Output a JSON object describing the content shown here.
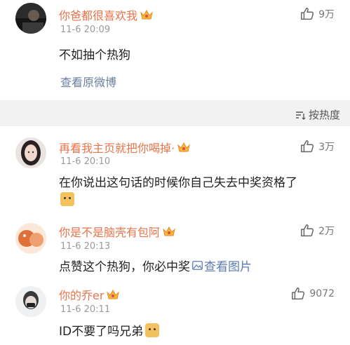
{
  "main_post": {
    "username": "你爸都很喜欢我",
    "time": "11-6 20:09",
    "text": "不如抽个热狗",
    "likes": "9万",
    "view_original": "查看原微博"
  },
  "sort": {
    "label": "按热度"
  },
  "comments": [
    {
      "username": "再看我主页就把你喝掉·",
      "time": "11-6 20:10",
      "text": "在你说出这句话的时候你自己失去中奖资格了",
      "likes": "3万",
      "has_emoji_line": true
    },
    {
      "username": "你是不是脑壳有包阿",
      "time": "11-6 20:13",
      "text": "点赞这个热狗，你必中奖",
      "image_link": "查看图片",
      "likes": "2万"
    },
    {
      "username": "你的乔er",
      "time": "11-6 20:11",
      "text": "ID不要了吗兄弟",
      "likes": "9072",
      "trailing_emoji": true
    }
  ],
  "colors": {
    "username": "#e8734a",
    "link": "#6a7fa0",
    "time": "#9a9a9a",
    "gap": "#f2f2f2"
  },
  "icons": [
    "thumbs-up-icon",
    "crown-icon",
    "sort-icon",
    "image-icon",
    "doge-emoji"
  ]
}
